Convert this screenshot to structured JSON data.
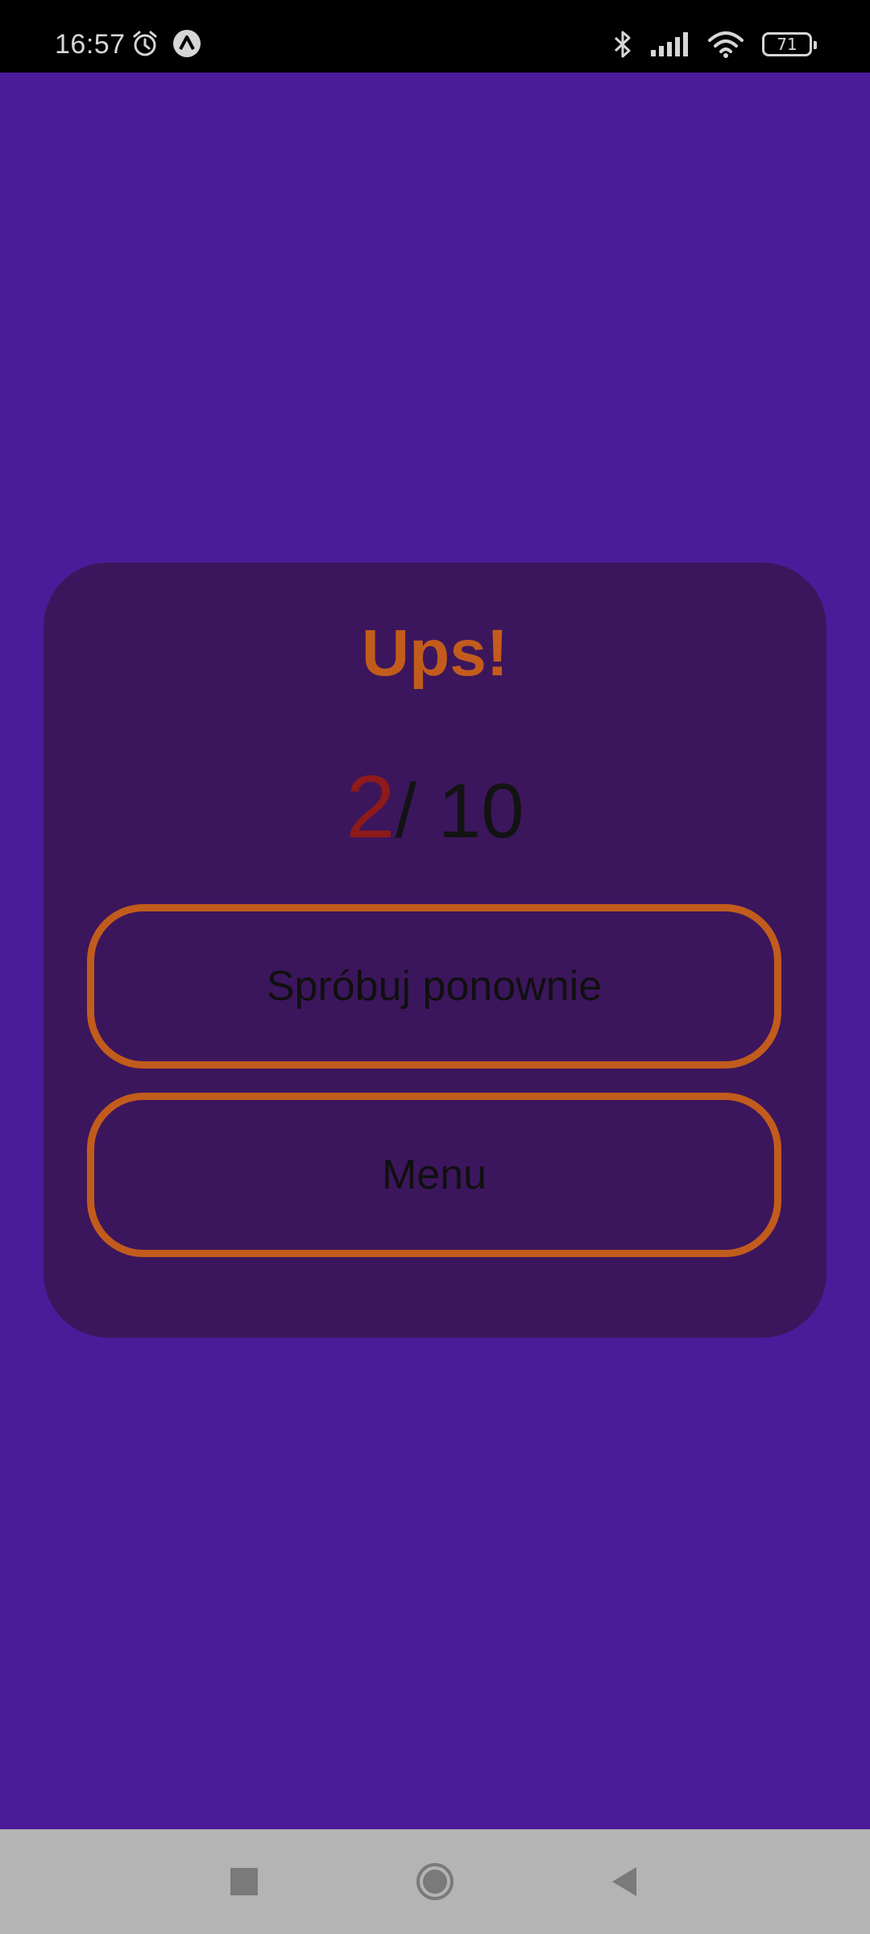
{
  "status_bar": {
    "time": "16:57",
    "icons": [
      "alarm-icon",
      "app-notification-icon",
      "bluetooth-icon",
      "signal-icon",
      "wifi-icon",
      "battery-icon"
    ],
    "battery_level": "71"
  },
  "result_card": {
    "title": "Ups!",
    "score_current": "2",
    "score_total": "/ 10",
    "buttons": {
      "retry_label": "Spróbuj ponownie",
      "menu_label": "Menu"
    }
  },
  "nav_bar": {
    "icons": [
      "recent-apps-icon",
      "home-icon",
      "back-icon"
    ]
  },
  "colors": {
    "background": "#4b1c9a",
    "card": "#3c165c",
    "accent": "#c25c1c",
    "score_current": "#8e1a1a"
  }
}
